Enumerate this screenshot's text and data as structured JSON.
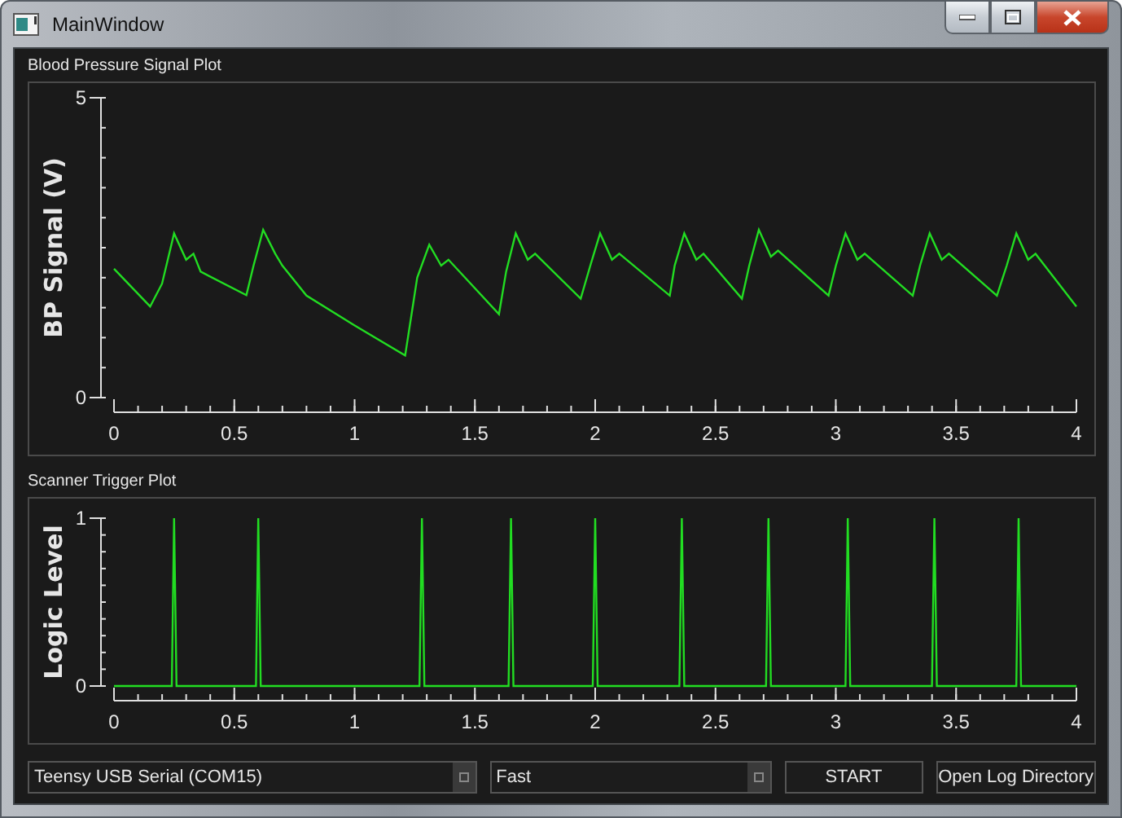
{
  "window": {
    "title": "MainWindow"
  },
  "plots": [
    {
      "chart_data": {
        "type": "line",
        "title": "Blood Pressure Signal Plot",
        "ylabel": "BP Signal (V)",
        "xlim": [
          0,
          4
        ],
        "ylim": [
          0,
          5
        ],
        "xticks": [
          0,
          0.5,
          1,
          1.5,
          2,
          2.5,
          3,
          3.5,
          4
        ],
        "yticks": [
          0,
          5
        ],
        "x": [
          0,
          0.15,
          0.2,
          0.25,
          0.3,
          0.33,
          0.36,
          0.55,
          0.58,
          0.62,
          0.67,
          0.7,
          0.8,
          1.0,
          1.21,
          1.26,
          1.31,
          1.36,
          1.39,
          1.6,
          1.63,
          1.67,
          1.72,
          1.75,
          1.94,
          1.98,
          2.02,
          2.07,
          2.1,
          2.31,
          2.33,
          2.37,
          2.42,
          2.45,
          2.61,
          2.64,
          2.68,
          2.73,
          2.76,
          2.97,
          3.0,
          3.04,
          3.09,
          3.12,
          3.32,
          3.35,
          3.39,
          3.44,
          3.47,
          3.67,
          3.71,
          3.75,
          3.8,
          3.83,
          4.0
        ],
        "series": [
          {
            "color": "#22dd22",
            "values": [
              2.15,
              1.52,
              1.9,
              2.74,
              2.3,
              2.4,
              2.1,
              1.71,
              2.2,
              2.8,
              2.4,
              2.2,
              1.7,
              1.2,
              0.7,
              2.0,
              2.55,
              2.2,
              2.3,
              1.39,
              2.1,
              2.74,
              2.3,
              2.4,
              1.65,
              2.2,
              2.74,
              2.3,
              2.4,
              1.7,
              2.2,
              2.74,
              2.3,
              2.4,
              1.65,
              2.2,
              2.8,
              2.35,
              2.45,
              1.7,
              2.2,
              2.74,
              2.3,
              2.4,
              1.7,
              2.2,
              2.74,
              2.3,
              2.4,
              1.7,
              2.2,
              2.74,
              2.3,
              2.4,
              1.52
            ]
          }
        ]
      }
    },
    {
      "chart_data": {
        "type": "line",
        "title": "Scanner Trigger Plot",
        "ylabel": "Logic Level",
        "xlim": [
          0,
          4
        ],
        "ylim": [
          0,
          1
        ],
        "xticks": [
          0,
          0.5,
          1,
          1.5,
          2,
          2.5,
          3,
          3.5,
          4
        ],
        "yticks": [
          0,
          1
        ],
        "x": [
          0,
          0.24,
          0.25,
          0.26,
          0.59,
          0.6,
          0.61,
          1.27,
          1.28,
          1.29,
          1.64,
          1.65,
          1.66,
          1.99,
          2.0,
          2.01,
          2.35,
          2.36,
          2.37,
          2.71,
          2.72,
          2.73,
          3.04,
          3.05,
          3.06,
          3.4,
          3.41,
          3.42,
          3.75,
          3.76,
          3.77,
          4.0
        ],
        "series": [
          {
            "color": "#22dd22",
            "values": [
              0,
              0,
              1,
              0,
              0,
              1,
              0,
              0,
              1,
              0,
              0,
              1,
              0,
              0,
              1,
              0,
              0,
              1,
              0,
              0,
              1,
              0,
              0,
              1,
              0,
              0,
              1,
              0,
              0,
              1,
              0,
              0
            ]
          }
        ]
      }
    }
  ],
  "controls": [
    {
      "kind": "combo",
      "value": "Teensy USB Serial (COM15)"
    },
    {
      "kind": "combo",
      "value": "Fast"
    },
    {
      "kind": "button",
      "label": "START"
    },
    {
      "kind": "button",
      "label": "Open Log Directory"
    }
  ]
}
